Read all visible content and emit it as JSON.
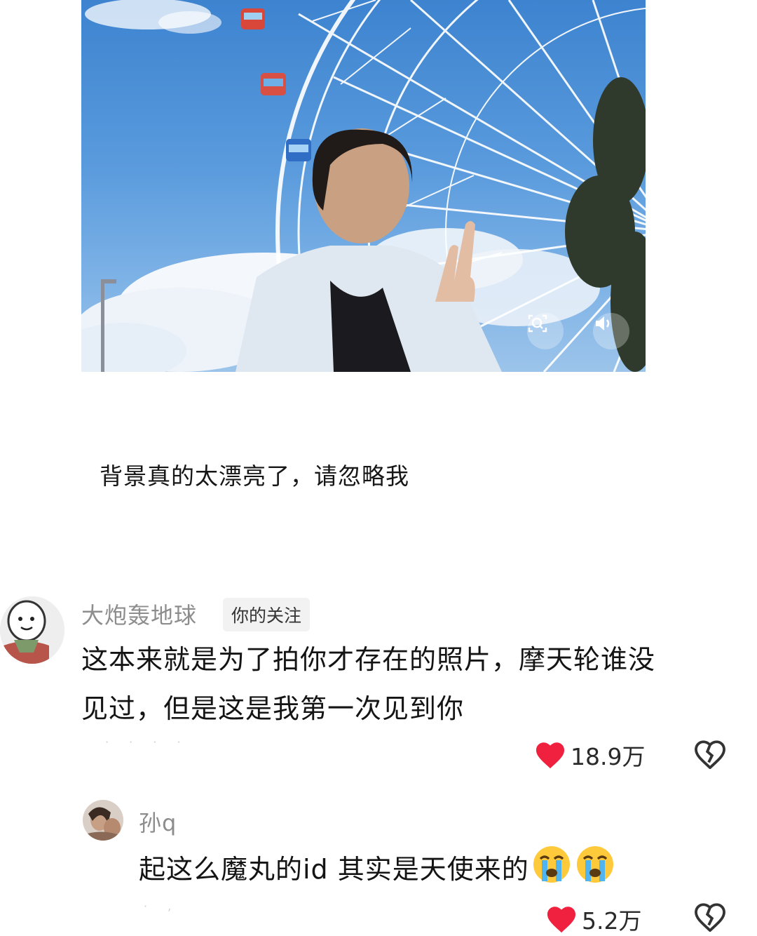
{
  "post": {
    "caption": "背景真的太漂亮了，请忽略我",
    "media": {
      "zoom_icon": "zoom-icon",
      "sound_icon": "speaker-icon"
    }
  },
  "comments": [
    {
      "username": "大炮轰地球",
      "tag": "你的关注",
      "line1": "这本来就是为了拍你才存在的照片，摩天轮谁没",
      "line2": "见过，但是这是我第一次见到你",
      "faint": "· · · ·",
      "likes": "18.9万"
    },
    {
      "username": "孙q",
      "text": "起这么魔丸的id 其实是天使来的",
      "faint": "· ,",
      "likes": "5.2万"
    }
  ],
  "colors": {
    "heart": "#f0213f",
    "username": "#8d8d8d",
    "text": "#141414"
  }
}
